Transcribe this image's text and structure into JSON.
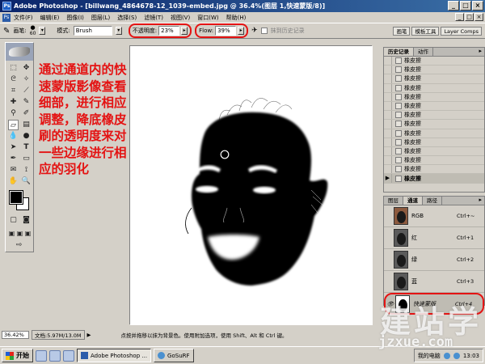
{
  "window": {
    "title": "Adobe Photoshop - [billwang_4864678-12_1039-embed.jpg @ 36.4%(图层 1,快速蒙版/8)]",
    "app_icon": "photoshop-icon",
    "controls": [
      "_",
      "□",
      "×"
    ]
  },
  "menubar": {
    "items": [
      "文件(F)",
      "编辑(E)",
      "图像(I)",
      "图层(L)",
      "选择(S)",
      "滤镜(T)",
      "视图(V)",
      "窗口(W)",
      "帮助(H)"
    ],
    "mdi_controls": [
      "_",
      "□",
      "×"
    ]
  },
  "options": {
    "brush_label": "画笔:",
    "brush_size": "60",
    "mode_label": "模式:",
    "mode_value": "Brush",
    "opacity_label": "不透明度:",
    "opacity_value": "23%",
    "flow_label": "Flow:",
    "flow_value": "39%",
    "erase_history_label": "抹到历史记录",
    "palette_tabs": [
      "画笔",
      "模板工具",
      "Layer Comps"
    ],
    "highlight_color": "#e41313"
  },
  "annotation": {
    "text": "通过通道内的快速蒙版影像查看细部，进行相应调整，降底橡皮刷的透明度来对一些边缘进行相应的羽化",
    "color": "#e41313"
  },
  "history": {
    "tabs": [
      "历史记录",
      "动作"
    ],
    "items": [
      "橡皮擦",
      "橡皮擦",
      "橡皮擦",
      "橡皮擦",
      "橡皮擦",
      "橡皮擦",
      "橡皮擦",
      "橡皮擦",
      "橡皮擦",
      "橡皮擦",
      "橡皮擦",
      "橡皮擦",
      "橡皮擦",
      "橡皮擦"
    ],
    "selected_index": 13
  },
  "channels": {
    "tabs": [
      "图层",
      "通道",
      "路径"
    ],
    "active_tab": 1,
    "rows": [
      {
        "name": "RGB",
        "key": "Ctrl+~"
      },
      {
        "name": "红",
        "key": "Ctrl+1"
      },
      {
        "name": "绿",
        "key": "Ctrl+2"
      },
      {
        "name": "蓝",
        "key": "Ctrl+3"
      },
      {
        "name": "快速蒙版",
        "key": "Ctrl+4"
      }
    ],
    "selected_index": 4
  },
  "statusbar": {
    "zoom": "36.42%",
    "doc_size": "文档:5.97M/13.0M",
    "hint": "点按并拖移以抹为背景色。使用附加选项，使用 Shift、Alt 和 Ctrl 键。"
  },
  "taskbar": {
    "start_label": "开始",
    "tasks": [
      {
        "label": "Adobe Photoshop ...",
        "icon": "photoshop-icon"
      },
      {
        "label": "GoSuRF",
        "icon": "browser-icon"
      }
    ],
    "tray_text": "我的电脑",
    "clock": "13:03"
  },
  "watermark": {
    "brand": "建站学",
    "url": "jzxue.com"
  }
}
